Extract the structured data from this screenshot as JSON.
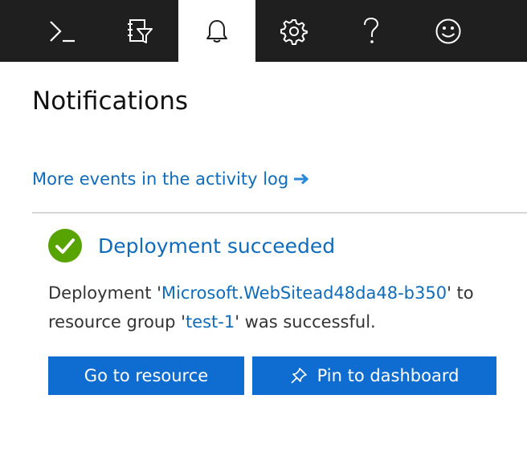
{
  "topbar": {
    "buttons": [
      {
        "name": "cloud-shell",
        "icon": "terminal-prompt-icon"
      },
      {
        "name": "directory-filter",
        "icon": "directory-filter-icon"
      },
      {
        "name": "notifications",
        "icon": "bell-icon",
        "active": true
      },
      {
        "name": "settings",
        "icon": "gear-icon"
      },
      {
        "name": "help",
        "icon": "question-mark-icon"
      },
      {
        "name": "feedback",
        "icon": "smiley-icon"
      }
    ]
  },
  "panel": {
    "title": "Notifications",
    "activity_link": "More events in the activity log"
  },
  "notification": {
    "status": "success",
    "title": "Deployment succeeded",
    "body": {
      "prefix": "Deployment '",
      "deployment_name": "Microsoft.WebSitead48da48-b350",
      "middle": "' to resource group '",
      "resource_group": "test-1",
      "suffix": "' was successful."
    },
    "actions": {
      "go_to_resource": "Go to resource",
      "pin_to_dashboard": "Pin to dashboard"
    }
  },
  "colors": {
    "topbar_bg": "#1f1f1f",
    "link": "#0f6cbd",
    "button_bg": "#0f6cd0",
    "success": "#57a300",
    "divider": "#d6d6d6"
  }
}
